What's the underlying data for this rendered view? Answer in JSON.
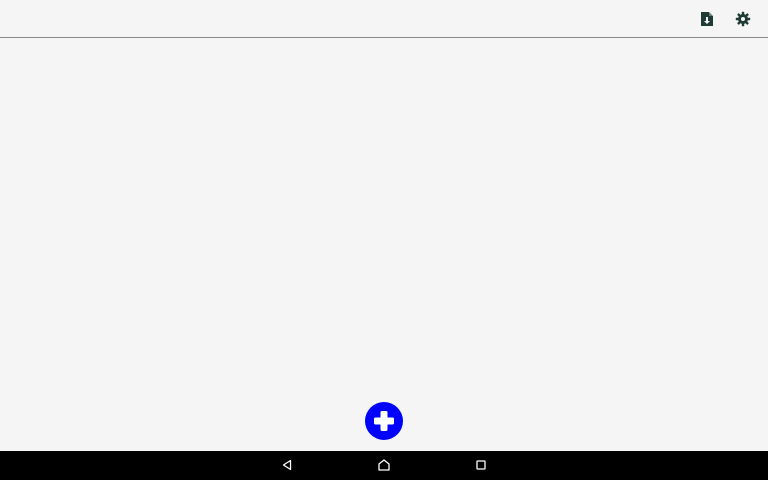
{
  "toolbar": {
    "icons": [
      "export-file-icon",
      "settings-gear-icon"
    ]
  },
  "fab": {
    "icon": "add-plus-icon",
    "color": "#0000ff"
  },
  "navigation_bar": {
    "icons": [
      "back-triangle-icon",
      "home-icon",
      "recents-square-icon"
    ]
  },
  "colors": {
    "background": "#f5f5f5",
    "toolbar_icon": "#1f3b35",
    "fab": "#0000ff",
    "navbar": "#000000"
  }
}
